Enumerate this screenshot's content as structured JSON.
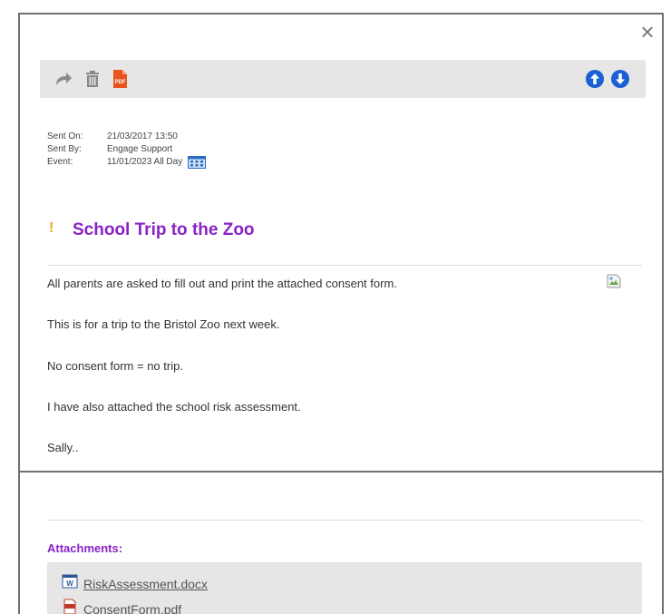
{
  "dialog": {
    "close_label": "×"
  },
  "toolbar": {
    "icons": [
      "forward-icon",
      "trash-icon",
      "pdf-icon",
      "arrow-up-circle-icon",
      "arrow-down-circle-icon"
    ],
    "pdf_text": "PDF"
  },
  "meta": {
    "sent_on_label": "Sent On:",
    "sent_on_value": "21/03/2017 13:50",
    "sent_by_label": "Sent By:",
    "sent_by_value": "Engage Support",
    "event_label": "Event:",
    "event_value": "11/01/2023 All Day"
  },
  "message": {
    "priority_mark": "!",
    "subject": "School Trip to the Zoo",
    "lines": [
      "All parents are asked to fill out and print the attached consent form.",
      "This is for a trip to the Bristol Zoo next week.",
      "No consent form = no trip.",
      "I have also attached the school risk assessment.",
      "Sally.."
    ]
  },
  "attachments": {
    "title": "Attachments:",
    "files": [
      "RiskAssessment.docx",
      "ConsentForm.pdf"
    ]
  },
  "colors": {
    "accent_purple": "#8a22c4",
    "priority_orange": "#f0a020",
    "nav_blue": "#1a5fd6",
    "pdf_orange": "#e8541c",
    "toolbar_gray": "#e6e6e6"
  }
}
